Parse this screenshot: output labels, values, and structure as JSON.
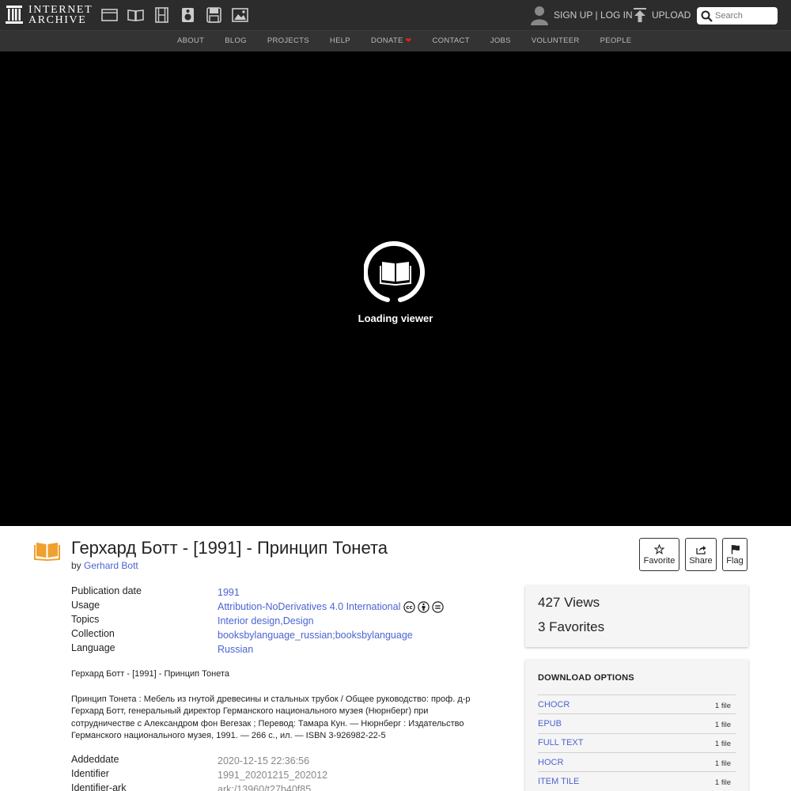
{
  "header": {
    "logo_line1": "INTERNET",
    "logo_line2": "ARCHIVE",
    "media_icons": [
      "web-icon",
      "texts-icon",
      "video-icon",
      "audio-icon",
      "software-icon",
      "images-icon"
    ],
    "sign_up": "SIGN UP",
    "separator": "|",
    "log_in": "LOG IN",
    "upload": "UPLOAD",
    "search_placeholder": "Search"
  },
  "nav": {
    "items": [
      "ABOUT",
      "BLOG",
      "PROJECTS",
      "HELP",
      "DONATE",
      "CONTACT",
      "JOBS",
      "VOLUNTEER",
      "PEOPLE"
    ],
    "donate_heart": "❤"
  },
  "viewer": {
    "loading_text": "Loading viewer"
  },
  "item": {
    "title": "Герхард Ботт - [1991] - Принцип Тонета",
    "by_label": "by",
    "author": "Gerhard Bott",
    "actions": {
      "favorite": "Favorite",
      "share": "Share",
      "flag": "Flag"
    },
    "metadata": {
      "publication_date_label": "Publication date",
      "publication_date": "1991",
      "usage_label": "Usage",
      "usage": "Attribution-NoDerivatives 4.0 International",
      "topics_label": "Topics",
      "topic1": "Interior design",
      "topic_sep": ", ",
      "topic2": "Design",
      "collection_label": "Collection",
      "collection1": "booksbylanguage_russian",
      "collection_sep": "; ",
      "collection2": "booksbylanguage",
      "language_label": "Language",
      "language": "Russian"
    },
    "description": {
      "line1": "Герхард Ботт - [1991] - Принцип Тонета",
      "paragraph": "Принцип Тонета : Мебель из гнутой древесины и стальных трубок / Общее руководство: проф. д-р Герхард Ботт, генеральный директор Германского национального музея (Нюрнберг) при сотрудничестве с Александром фон Вегезак ; Перевод: Тамара Кун. — Нюрнберг : Издательство Германского национального музея, 1991. — 266 с., ил. — ISBN 3-926982-22-5"
    },
    "metadata2": {
      "addeddate_label": "Addeddate",
      "addeddate": "2020-12-15 22:36:56",
      "identifier_label": "Identifier",
      "identifier": "1991_20201215_202012",
      "identifier_ark_label": "Identifier-ark",
      "identifier_ark": "ark:/13960/t27b40f85"
    }
  },
  "stats": {
    "views": "427 Views",
    "favorites": "3 Favorites"
  },
  "downloads": {
    "title": "DOWNLOAD OPTIONS",
    "items": [
      {
        "format": "CHOCR",
        "count": "1 file"
      },
      {
        "format": "EPUB",
        "count": "1 file"
      },
      {
        "format": "FULL TEXT",
        "count": "1 file"
      },
      {
        "format": "HOCR",
        "count": "1 file"
      },
      {
        "format": "ITEM TILE",
        "count": "1 file"
      }
    ]
  },
  "colors": {
    "topbar": "#2c2c2c",
    "link": "#4b64d1",
    "book_icon": "#f0a030",
    "heart": "#e02020"
  }
}
